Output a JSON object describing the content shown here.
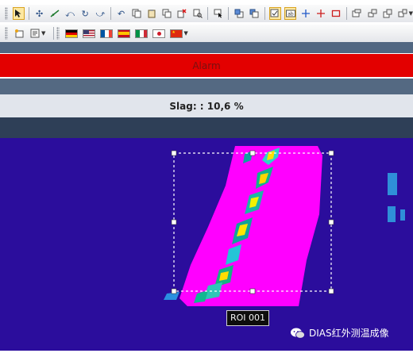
{
  "toolbar_top": {
    "buttons": [
      "select-arrow-icon",
      "move-point-icon",
      "edit-line-icon",
      "rotate-left-icon",
      "rotate-icon",
      "rotate-right-icon",
      "undo-icon",
      "copy-icon",
      "paste-icon",
      "duplicate-icon",
      "delete-icon",
      "find-icon",
      "pointer-icon",
      "bring-forward-icon",
      "send-backward-icon",
      "note-icon",
      "text-label-icon",
      "crosshair-icon",
      "crosshair-red-icon",
      "rectangle-icon",
      "window-a-icon",
      "window-b-icon",
      "window-c-icon",
      "window-d-icon"
    ]
  },
  "toolbar_languages": {
    "flags": [
      "German",
      "English",
      "French",
      "Spanish",
      "Italian",
      "Japanese",
      "Chinese"
    ]
  },
  "alarm": {
    "label": "Alarm",
    "color": "#e30000"
  },
  "slag": {
    "label": "Slag: : 10,6 %"
  },
  "thermal_image": {
    "background_color": "#2b0d9c",
    "hot_color": "#ff00ff",
    "roi_label": "ROI 001"
  },
  "watermark": {
    "text": "DIAS红外测温成像"
  }
}
